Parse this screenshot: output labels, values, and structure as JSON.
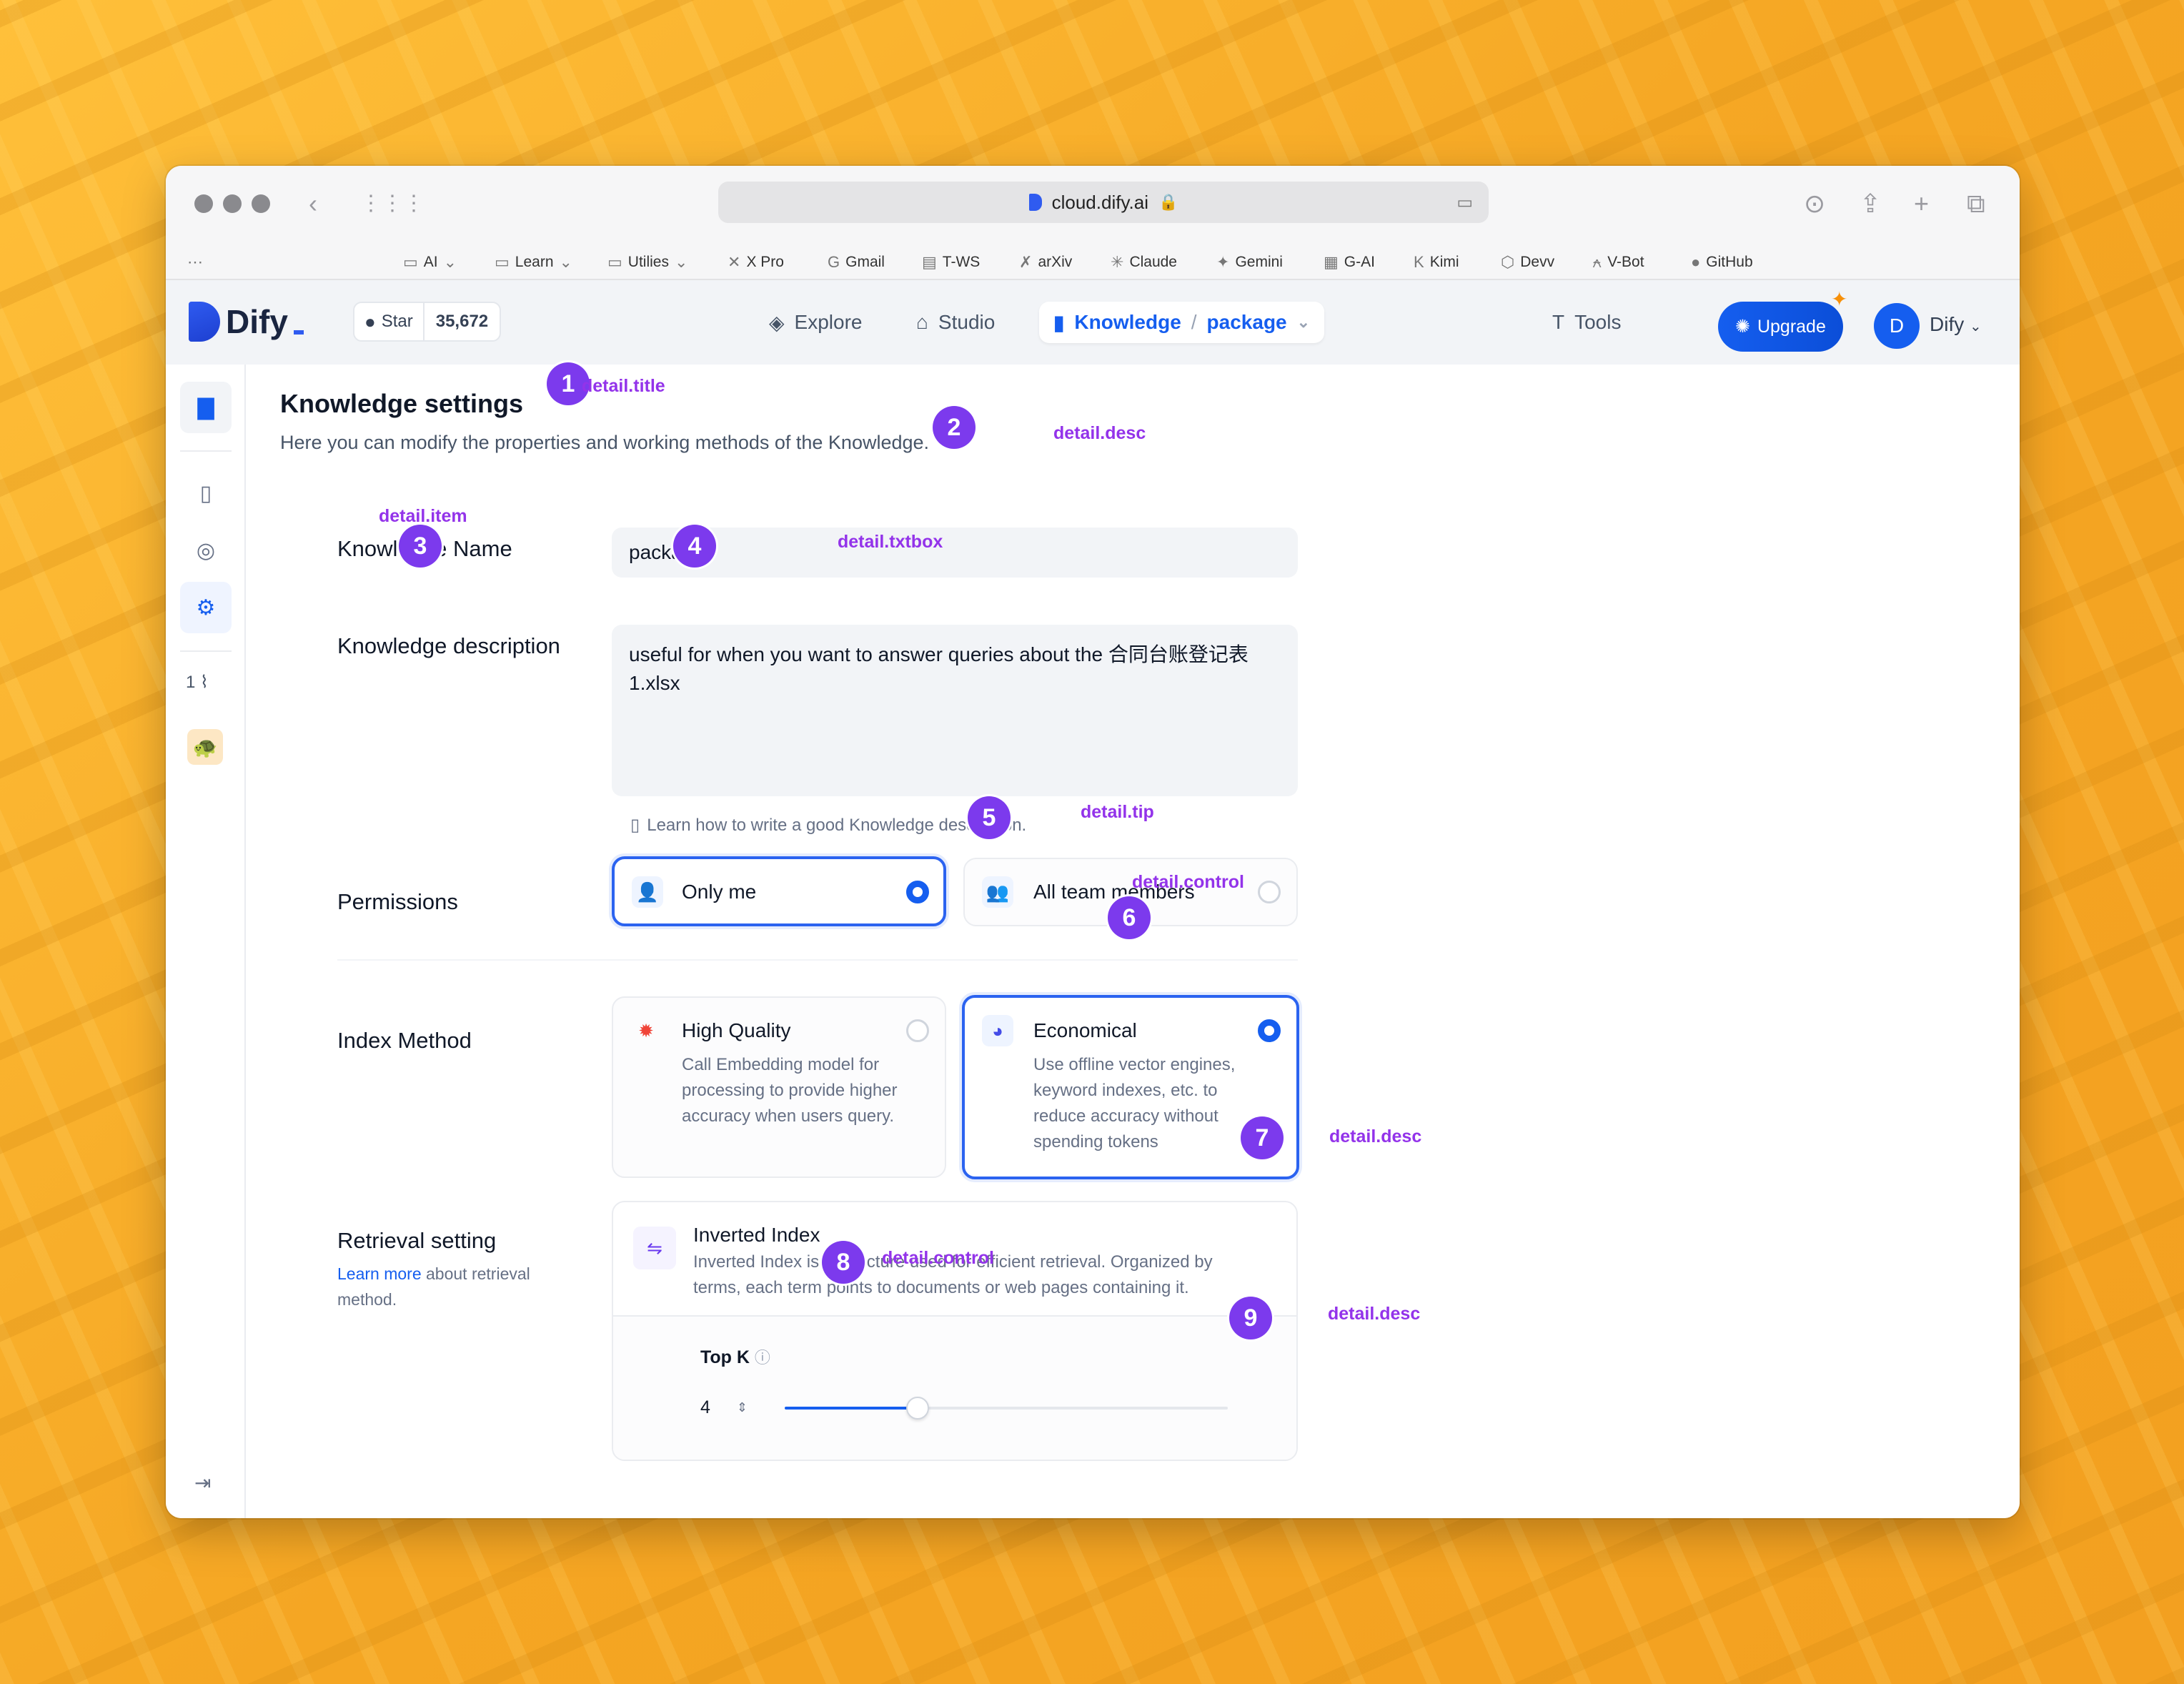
{
  "browser": {
    "url": "cloud.dify.ai",
    "bookmarks": [
      {
        "label": "AI",
        "icon": "folder-icon"
      },
      {
        "label": "Learn",
        "icon": "folder-icon"
      },
      {
        "label": "Utilies",
        "icon": "folder-icon"
      },
      {
        "label": "X Pro",
        "icon": "x-icon"
      },
      {
        "label": "Gmail",
        "icon": "google-icon"
      },
      {
        "label": "T-WS",
        "icon": "site-icon"
      },
      {
        "label": "arXiv",
        "icon": "arxiv-icon"
      },
      {
        "label": "Claude",
        "icon": "claude-icon"
      },
      {
        "label": "Gemini",
        "icon": "gemini-icon"
      },
      {
        "label": "G-AI",
        "icon": "site-icon"
      },
      {
        "label": "Kimi",
        "icon": "kimi-icon"
      },
      {
        "label": "Devv",
        "icon": "devv-icon"
      },
      {
        "label": "V-Bot",
        "icon": "vbot-icon"
      },
      {
        "label": "GitHub",
        "icon": "github-icon"
      }
    ]
  },
  "header": {
    "logo": "Dify",
    "star_label": "Star",
    "star_count": "35,672",
    "nav": {
      "explore": "Explore",
      "studio": "Studio",
      "knowledge": "Knowledge",
      "separator": "/",
      "dataset": "package",
      "tools": "Tools"
    },
    "upgrade": "Upgrade",
    "avatar_letter": "D",
    "user": "Dify"
  },
  "sidebar": {
    "attachment_count": "1"
  },
  "detail": {
    "title": "Knowledge settings",
    "desc": "Here you can modify the properties and working methods of the Knowledge.",
    "name_label": "Knowledge Name",
    "name_value": "package",
    "description_label": "Knowledge description",
    "description_value": "useful for when you want to answer queries about the 合同台账登记表 1.xlsx",
    "tip": "Learn how to write a good Knowledge description.",
    "permissions_label": "Permissions",
    "perm_only_me": "Only me",
    "perm_all": "All team members",
    "index_label": "Index Method",
    "hq_title": "High Quality",
    "hq_desc": "Call Embedding model for processing to provide higher accuracy when users query.",
    "eco_title": "Economical",
    "eco_desc": "Use offline vector engines, keyword indexes, etc. to reduce accuracy without spending tokens",
    "retrieval_label": "Retrieval setting",
    "retrieval_link": "Learn more",
    "retrieval_sub": " about retrieval method.",
    "inv_title": "Inverted Index",
    "inv_desc": "Inverted Index is a structure used for efficient retrieval. Organized by terms, each term points to documents or web pages containing it.",
    "topk_label": "Top K",
    "topk_value": "4",
    "topk_slider_fraction": 0.3
  },
  "annotations": {
    "badges": [
      "1",
      "2",
      "3",
      "4",
      "5",
      "6",
      "7",
      "8",
      "9"
    ],
    "labels": {
      "title": "detail.title",
      "desc": "detail.desc",
      "item": "detail.item",
      "txtbox": "detail.txtbox",
      "tip": "detail.tip",
      "control": "detail.control"
    }
  }
}
